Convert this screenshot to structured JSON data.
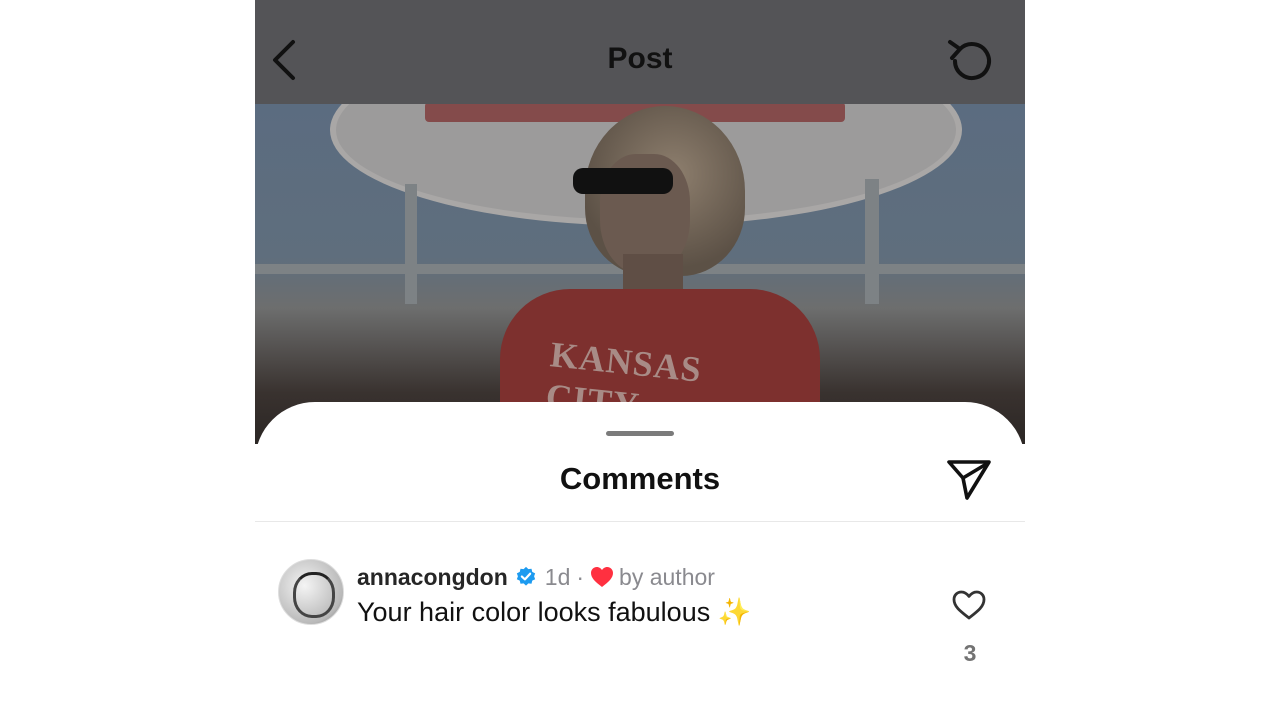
{
  "header": {
    "title": "Post"
  },
  "photo": {
    "shirt_text": "KANSAS CITY"
  },
  "sheet": {
    "title": "Comments"
  },
  "comment": {
    "username": "annacongdon",
    "time": "1d",
    "separator": "·",
    "liked_by_author_label": "by author",
    "text": "Your hair color looks fabulous",
    "emoji": "✨",
    "like_count": "3"
  },
  "icons": {
    "back": "chevron-left-icon",
    "refresh": "refresh-icon",
    "share": "send-icon",
    "verified": "verified-badge-icon",
    "author_heart": "heart-filled-icon",
    "like": "heart-outline-icon"
  },
  "colors": {
    "verified_blue": "#1d9bf0",
    "heart_red": "#ff3040",
    "overlay": "#545457"
  }
}
